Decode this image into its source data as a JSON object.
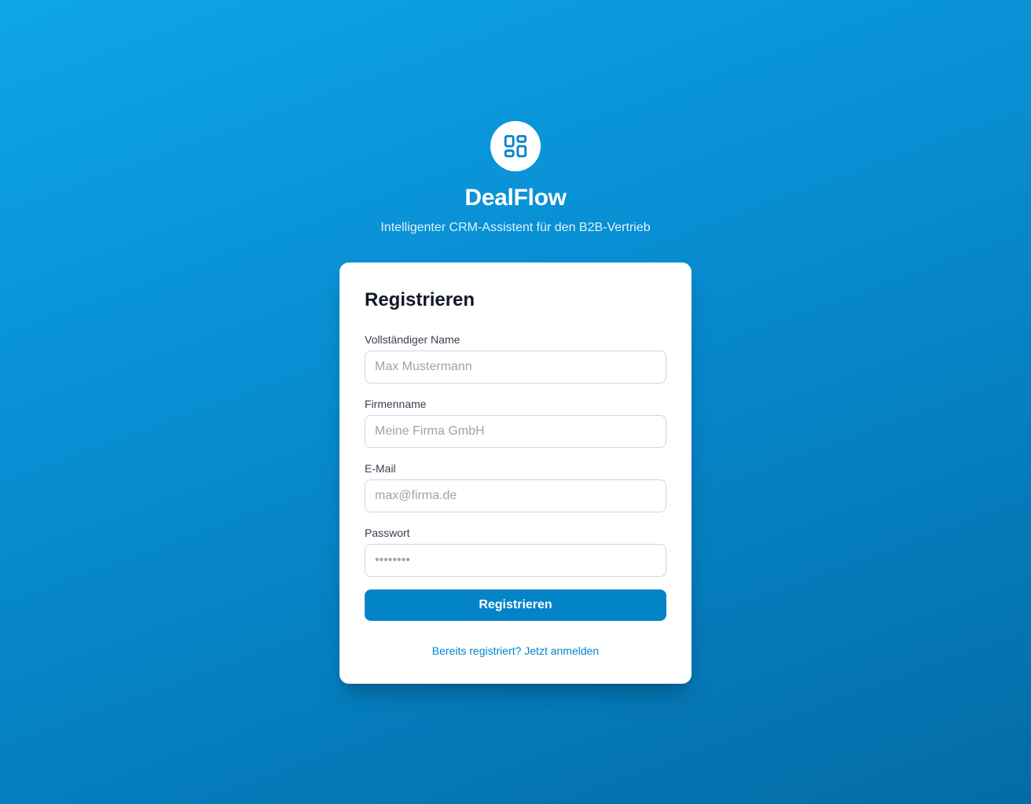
{
  "brand": {
    "logo_icon": "dashboard-grid-icon",
    "app_name": "DealFlow",
    "tagline": "Intelligenter CRM-Assistent für den B2B-Vertrieb"
  },
  "form": {
    "title": "Registrieren",
    "fields": [
      {
        "label": "Vollständiger Name",
        "placeholder": "Max Mustermann",
        "type": "text"
      },
      {
        "label": "Firmenname",
        "placeholder": "Meine Firma GmbH",
        "type": "text"
      },
      {
        "label": "E-Mail",
        "placeholder": "max@firma.de",
        "type": "email"
      },
      {
        "label": "Passwort",
        "placeholder": "••••••••",
        "type": "password"
      }
    ],
    "submit_label": "Registrieren",
    "login_link": "Bereits registriert? Jetzt anmelden"
  },
  "colors": {
    "accent": "#0284c7",
    "background_gradient": [
      "#0ea5e9",
      "#036ca6"
    ]
  }
}
